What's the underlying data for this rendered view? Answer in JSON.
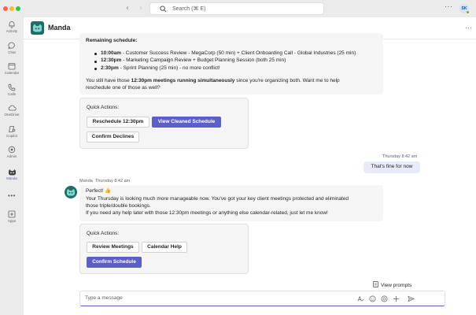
{
  "titlebar": {
    "search_placeholder": "Search (⌘ E)",
    "more_glyph": "···",
    "user_initials": "SK"
  },
  "rail": {
    "items": [
      {
        "label": "Activity",
        "icon": "bell-icon"
      },
      {
        "label": "Chat",
        "icon": "chat-icon"
      },
      {
        "label": "Calendar",
        "icon": "calendar-icon"
      },
      {
        "label": "Calls",
        "icon": "phone-icon"
      },
      {
        "label": "OneDrive",
        "icon": "cloud-icon"
      },
      {
        "label": "Copilot",
        "icon": "copilot-icon"
      },
      {
        "label": "Admin",
        "icon": "admin-icon"
      },
      {
        "label": "Manda",
        "icon": "manda-bot-icon"
      },
      {
        "label": "",
        "icon": "more-icon"
      },
      {
        "label": "Apps",
        "icon": "apps-icon"
      }
    ]
  },
  "header": {
    "title": "Manda",
    "more_glyph": "···"
  },
  "conversation": {
    "prev_message": {
      "heading": "Remaining schedule:",
      "items": [
        {
          "time": "10:00am",
          "text": " - Customer Success Review - MegaCorp (50 min) + Client Onboarding Call - Global Industries (25 min)"
        },
        {
          "time": "12:30pm",
          "text": " - Marketing Campaign Review + Budget Planning Session (both 25 min)"
        },
        {
          "time": "2:30pm",
          "text": " - Sprint Planning (25 min) - no more conflict!"
        }
      ],
      "note_pre": "You still have those ",
      "note_bold": "12:30pm meetings running simultaneously",
      "note_post": " since you're organizing both. Want me to help",
      "note_line2": "reschedule one of those as well?"
    },
    "card1": {
      "label": "Quick Actions:",
      "buttons": [
        "Reschedule 12:30pm",
        "View Cleaned Schedule",
        "Confirm Declines"
      ]
    },
    "user_message": {
      "timestamp": "Thursday 8:42 am",
      "text": "That's fine for now"
    },
    "bot_message": {
      "sender": "Manda",
      "timestamp": "Thursday 8:42 am",
      "line1": "Perfect! 👍",
      "line2": "Your Thursday is looking much more manageable now. You've got your key client meetings protected and eliminated",
      "line3": "those triple/double bookings.",
      "line4": "If you need any help later with those 12:30pm meetings or anything else calendar-related, just let me know!"
    },
    "card2": {
      "label": "Quick Actions:",
      "buttons": [
        "Review Meetings",
        "Calendar Help",
        "Confirm Schedule"
      ]
    }
  },
  "composer": {
    "view_prompts": "View prompts",
    "placeholder": "Type a message"
  },
  "colors": {
    "accent": "#5b5fc7",
    "bot_teal": "#1f6d68",
    "user_bubble": "#e8ebfa",
    "bot_bubble": "#f5f5f5"
  }
}
